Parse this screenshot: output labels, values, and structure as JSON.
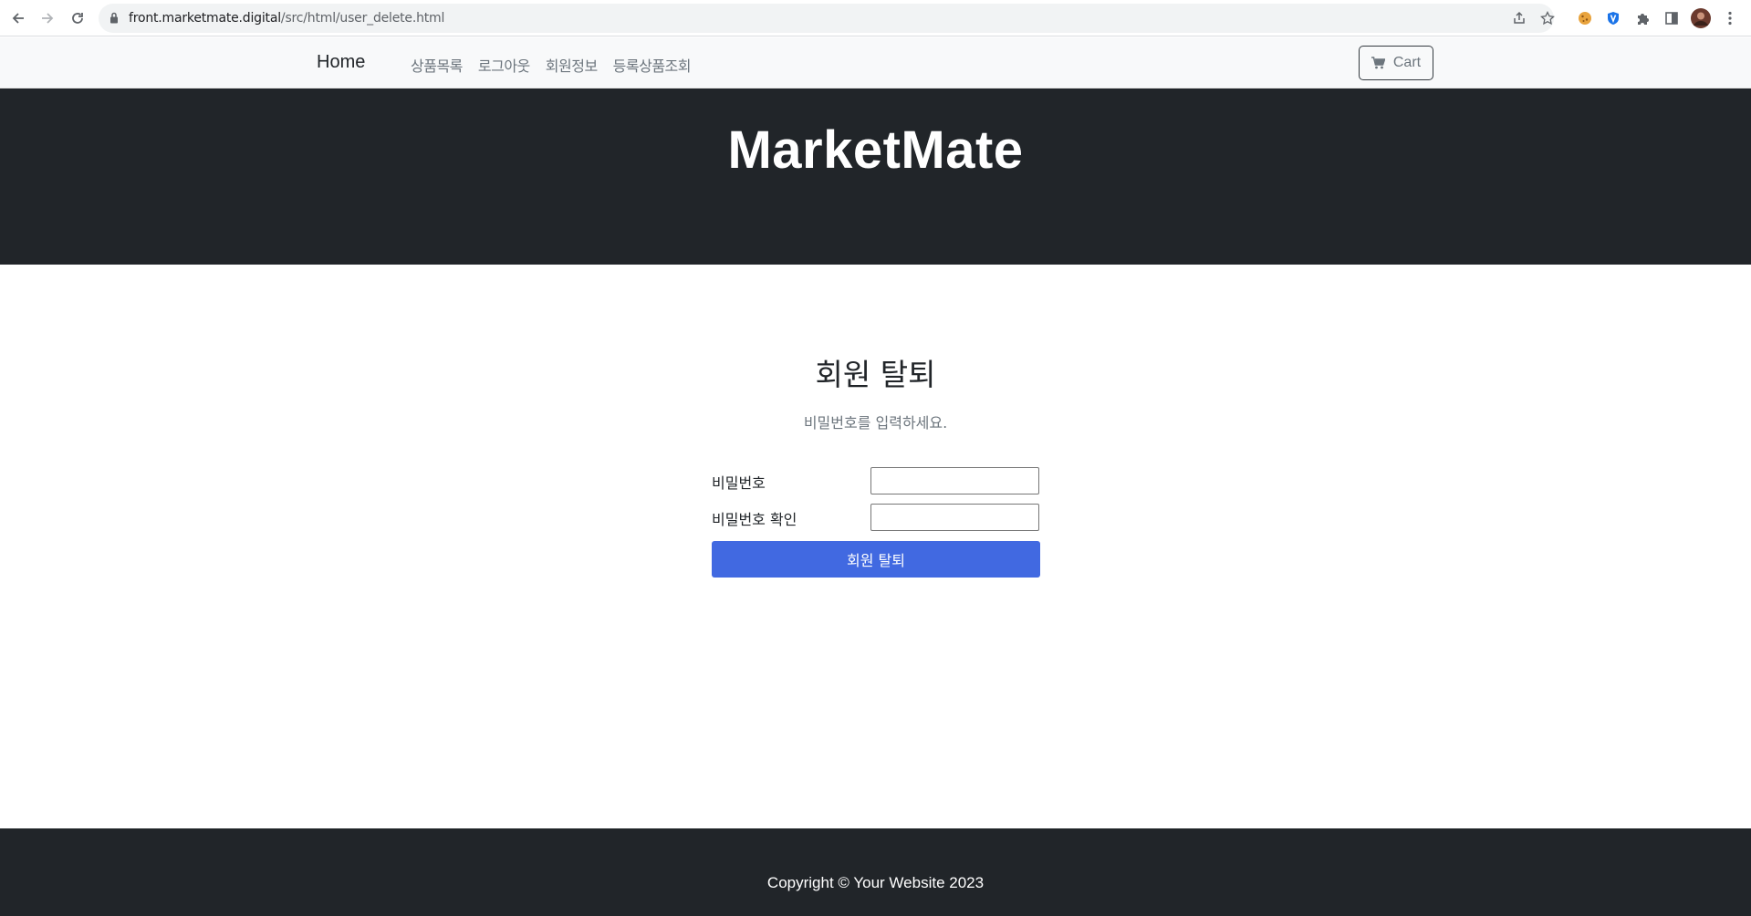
{
  "browser": {
    "url_host": "front.marketmate.digital",
    "url_path": "/src/html/user_delete.html"
  },
  "navbar": {
    "brand": "Home",
    "links": [
      "상품목록",
      "로그아웃",
      "회원정보",
      "등록상품조회"
    ],
    "cart_label": "Cart"
  },
  "header": {
    "title": "MarketMate"
  },
  "main": {
    "title": "회원 탈퇴",
    "subtitle": "비밀번호를 입력하세요.",
    "password_label": "비밀번호",
    "password_confirm_label": "비밀번호 확인",
    "password_value": "",
    "password_confirm_value": "",
    "submit_label": "회원 탈퇴"
  },
  "footer": {
    "copyright": "Copyright © Your Website 2023"
  },
  "colors": {
    "dark": "#212529",
    "navbar_bg": "#f8f9fa",
    "button": "#4169e1",
    "muted": "#6c757d"
  }
}
